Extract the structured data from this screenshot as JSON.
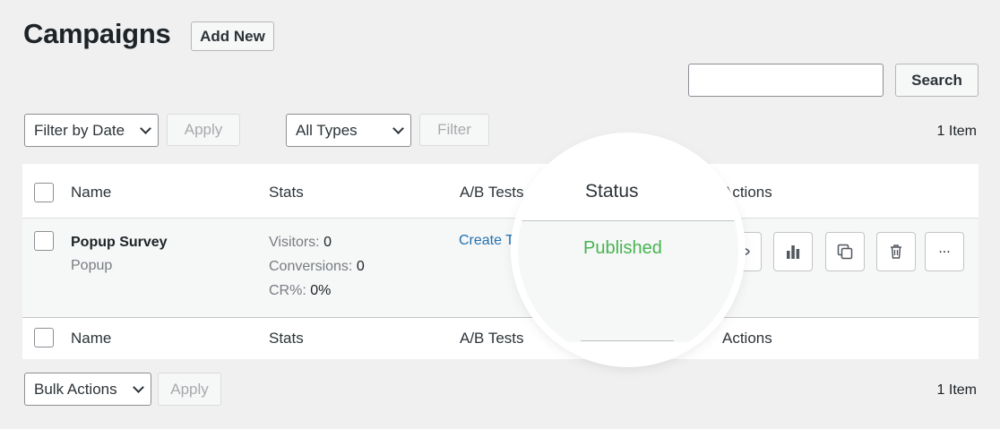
{
  "header": {
    "title": "Campaigns",
    "add_new_label": "Add New"
  },
  "search": {
    "button_label": "Search",
    "value": ""
  },
  "filters": {
    "date_select": "Filter by Date",
    "apply_label": "Apply",
    "type_select": "All Types",
    "filter_label": "Filter",
    "item_count": "1 Item"
  },
  "table": {
    "columns": {
      "name": "Name",
      "stats": "Stats",
      "ab_tests": "A/B Tests",
      "status": "Status",
      "actions": "Actions"
    },
    "rows": [
      {
        "name": "Popup Survey",
        "type": "Popup",
        "visitors_label": "Visitors:",
        "visitors": "0",
        "conversions_label": "Conversions:",
        "conversions": "0",
        "cr_label": "CR%:",
        "cr": "0%",
        "ab_link": "Create Te",
        "status": "Published",
        "action_more": "..."
      }
    ]
  },
  "bulk": {
    "select": "Bulk Actions",
    "apply_label": "Apply",
    "item_count": "1 Item"
  },
  "colors": {
    "published": "#46b450",
    "link": "#2271b1",
    "background": "#f0f0f1"
  },
  "icons": [
    "eye-icon",
    "bar-chart-icon",
    "duplicate-icon",
    "trash-icon",
    "ellipsis-icon",
    "chevron-down-icon"
  ]
}
